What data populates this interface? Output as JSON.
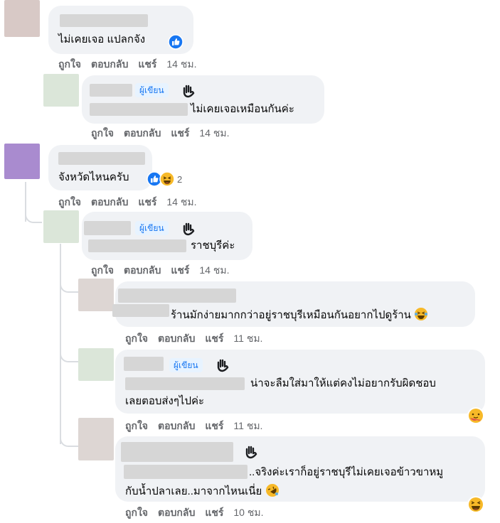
{
  "comments": [
    {
      "text": "ไม่เคยเจอ แปลกจัง",
      "like": "ถูกใจ",
      "reply": "ตอบกลับ",
      "share": "แชร์",
      "time": "14 ชม.",
      "reaction_icon": "like-icon"
    },
    {
      "badge": "ผู้เขียน",
      "text": "ไม่เคยเจอเหมือนกันค่ะ",
      "like": "ถูกใจ",
      "reply": "ตอบกลับ",
      "share": "แชร์",
      "time": "14 ชม."
    },
    {
      "text": "จังหวัดไหนครับ",
      "reaction_count": "2",
      "like": "ถูกใจ",
      "reply": "ตอบกลับ",
      "share": "แชร์",
      "time": "14 ชม."
    },
    {
      "badge": "ผู้เขียน",
      "text": "ราชบุรีค่ะ",
      "like": "ถูกใจ",
      "reply": "ตอบกลับ",
      "share": "แชร์",
      "time": "14 ชม."
    },
    {
      "text": "ร้านมักง่ายมากกว่าอยู่ราชบุรีเหมือนกันอยากไปดูร้าน",
      "like": "ถูกใจ",
      "reply": "ตอบกลับ",
      "share": "แชร์",
      "time": "11 ชม."
    },
    {
      "badge": "ผู้เขียน",
      "text_line1": "น่าจะลืมใส่มาให้แต่คงไม่อยากรับผิดชอบ",
      "text_line2": "เลยตอบส่งๆไปค่ะ",
      "like": "ถูกใจ",
      "reply": "ตอบกลับ",
      "share": "แชร์",
      "time": "11 ชม."
    },
    {
      "text_line1": "..จริงค่ะเราก็อยู่ราชบุรีไม่เคยเจอข้าวขาหมู",
      "text_line2": "กับน้ำปลาเลย..มาจากไหนเนี่ย",
      "like": "ถูกใจ",
      "reply": "ตอบกลับ",
      "share": "แชร์",
      "time": "10 ชม."
    }
  ],
  "colors": {
    "bubble": "#f0f2f5",
    "meta": "#65676b",
    "badge_bg": "#e7f3ff",
    "badge_text": "#1877f2",
    "like_blue": "#1877f2"
  }
}
